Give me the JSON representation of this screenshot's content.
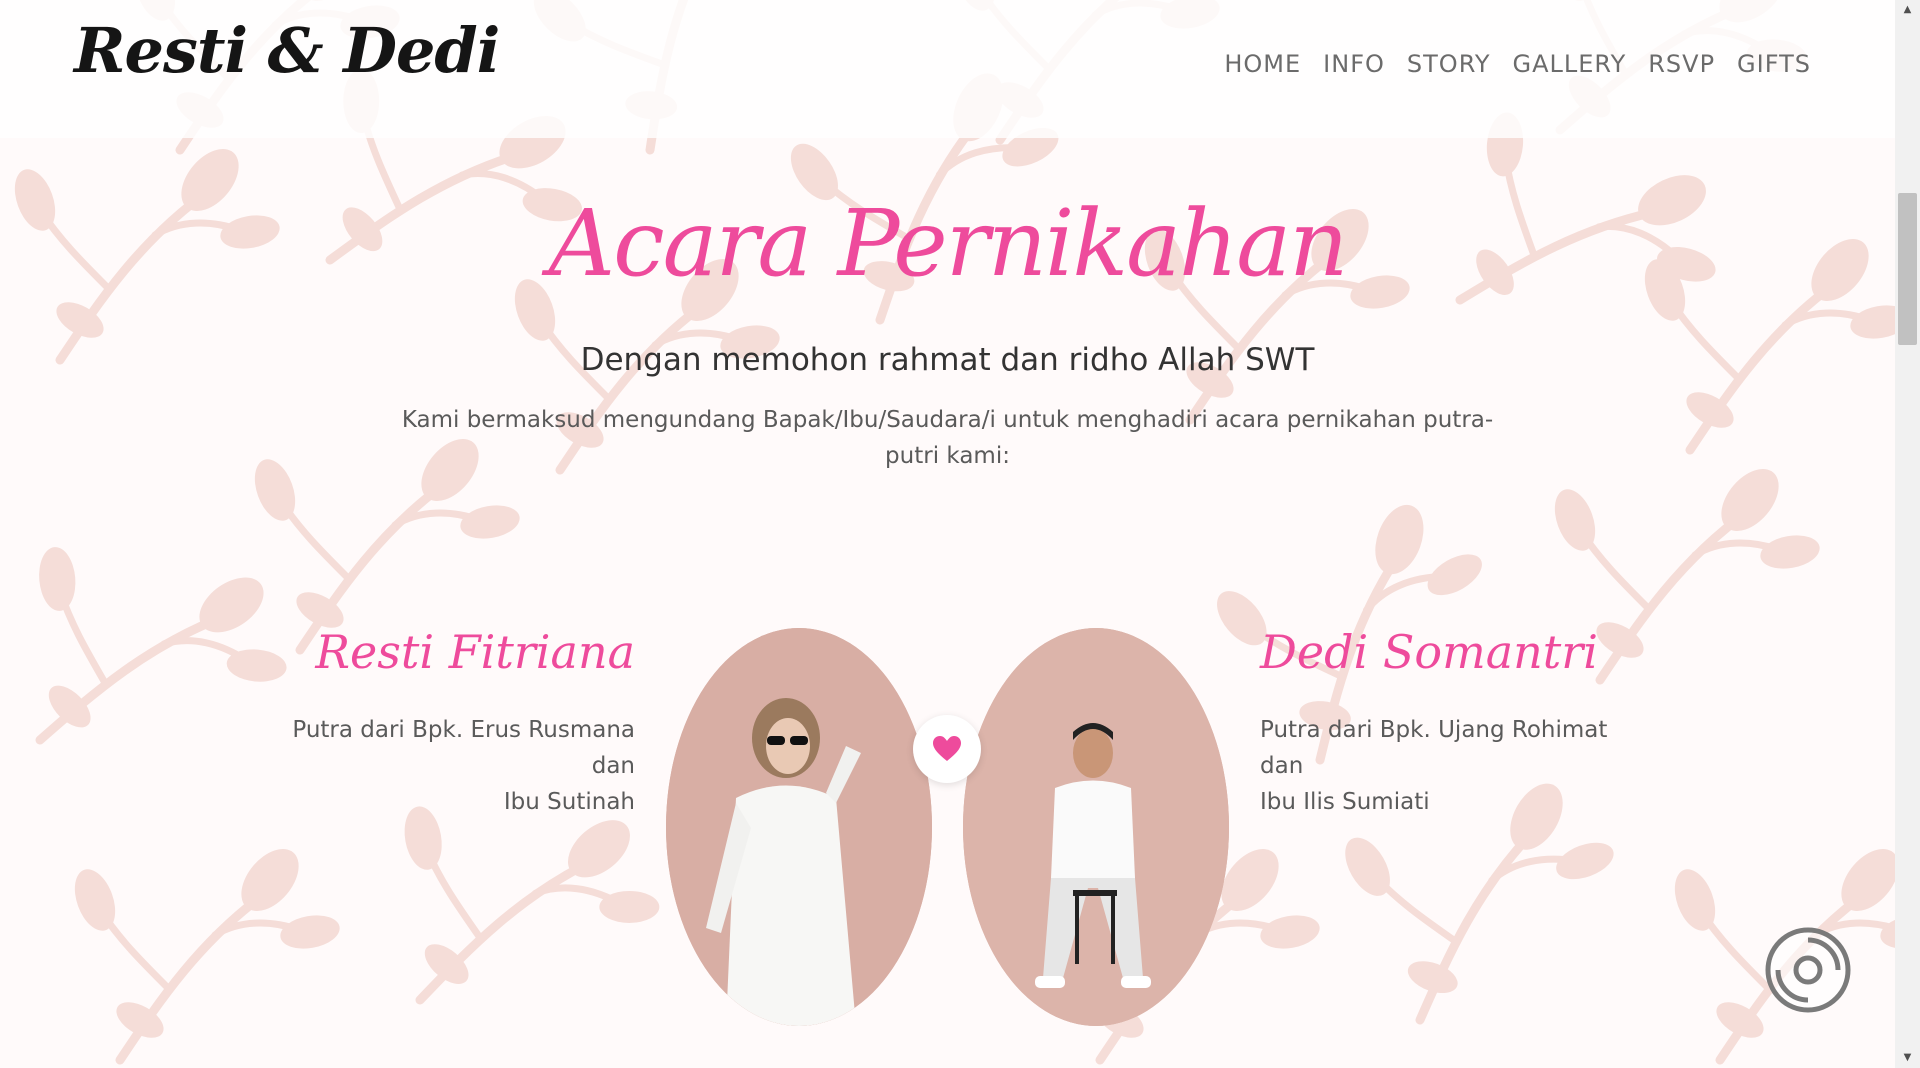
{
  "header": {
    "brand": "Resti & Dedi",
    "nav": [
      "HOME",
      "INFO",
      "STORY",
      "GALLERY",
      "RSVP",
      "GIFTS"
    ]
  },
  "section": {
    "title": "Acara Pernikahan",
    "subtitle": "Dengan memohon rahmat dan ridho Allah SWT",
    "intro": "Kami bermaksud mengundang Bapak/Ibu/Saudara/i untuk menghadiri acara pernikahan putra-putri kami:"
  },
  "bride": {
    "name": "Resti Fitriana",
    "line1": "Putra dari Bpk. Erus Rusmana",
    "line2": "dan",
    "line3": "Ibu Sutinah"
  },
  "groom": {
    "name": "Dedi Somantri",
    "line1": "Putra dari Bpk. Ujang Rohimat",
    "line2": "dan",
    "line3": "Ibu Ilis Sumiati"
  },
  "colors": {
    "accent": "#ee4b9c",
    "pattern": "#f5ddd8",
    "photo_bg": "#d9b0a6"
  },
  "icons": {
    "heart": "heart-icon",
    "music": "music-disc-icon"
  }
}
